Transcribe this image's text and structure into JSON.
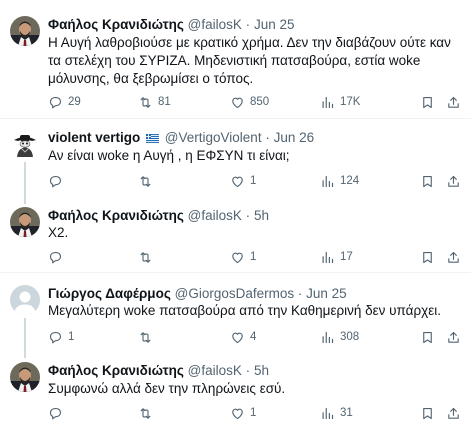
{
  "tweets": [
    {
      "name": "Φαήλος Κρανιδιώτης",
      "handle": "@failosK",
      "date": "Jun 25",
      "text": "Η Αυγή λαθροβιούσε με κρατικό χρήμα. Δεν την διαβάζουν ούτε καν τα στελέχη του ΣΥΡΙΖΑ. Μηδενιστική πατσαβούρα, εστία woke μόλυνσης, θα ξεβρωμίσει ο τόπος.",
      "replies": "29",
      "retweets": "81",
      "likes": "850",
      "views": "17K"
    },
    {
      "name": "violent vertigo",
      "handle": "@VertigoViolent",
      "date": "Jun 26",
      "text": "Αν είναι woke η Αυγή , η ΕΦΣΥΝ τι είναι;",
      "replies": "",
      "retweets": "",
      "likes": "1",
      "views": "124"
    },
    {
      "name": "Φαήλος Κρανιδιώτης",
      "handle": "@failosK",
      "date": "5h",
      "text": "Χ2.",
      "replies": "",
      "retweets": "",
      "likes": "1",
      "views": "17"
    },
    {
      "name": "Γιώργος Δαφέρμος",
      "handle": "@GiorgosDafermos",
      "date": "Jun 25",
      "text": "Μεγαλύτερη woke πατσαβούρα από την Καθημερινή δεν υπάρχει.",
      "replies": "1",
      "retweets": "",
      "likes": "4",
      "views": "308"
    },
    {
      "name": "Φαήλος Κρανιδιώτης",
      "handle": "@failosK",
      "date": "5h",
      "text": "Συμφωνώ αλλά δεν την πληρώνεις εσύ.",
      "replies": "",
      "retweets": "",
      "likes": "1",
      "views": "31"
    }
  ],
  "separator": "·",
  "icons": {
    "reply": "reply-icon",
    "retweet": "retweet-icon",
    "like": "like-icon",
    "views": "views-icon",
    "bookmark": "bookmark-icon",
    "share": "share-icon",
    "flag": "greece-flag-icon"
  },
  "colors": {
    "text": "#0f1419",
    "secondary": "#536471",
    "thread_line": "#cfd9de",
    "divider": "#eff3f4"
  }
}
